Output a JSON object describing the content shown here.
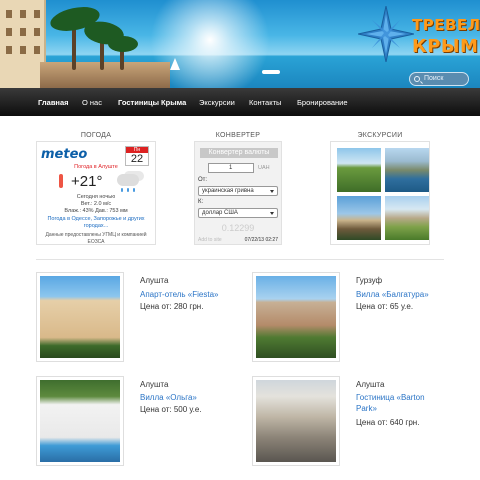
{
  "header": {
    "logo_line1": "ТРЕВЕЛ",
    "logo_line2": "КРЫМ",
    "search_placeholder": "Поиск",
    "accent": "#ff9a1a"
  },
  "nav": {
    "items": [
      {
        "label": "Главная",
        "bold": true
      },
      {
        "label": "О нас",
        "bold": false
      },
      {
        "label": "Гостиницы Крыма",
        "bold": true
      },
      {
        "label": "Экскурсии",
        "bold": false
      },
      {
        "label": "Контакты",
        "bold": false
      },
      {
        "label": "Бронирование",
        "bold": false
      }
    ]
  },
  "widgets": {
    "weather": {
      "title": "ПОГОДА",
      "brand": "meteo",
      "weekday": "Пн",
      "day": "22",
      "city": "Погода в Алуште",
      "temp": "+21°",
      "period": "Сегодня ночью",
      "wind": "Вет.: 2.0 м/с",
      "humidity_pressure": "Влаж.: 43%  Дав.: 753 мм",
      "links": "Погода в Одессе, Запорожье и других городах...",
      "credit": "Данные предоставлены УГМЦ и компанией",
      "partner": "ЕОЗСА"
    },
    "converter": {
      "title": "КОНВЕРТЕР",
      "header": "Конвертер валюты",
      "amount": "1",
      "amount_unit": "UAH",
      "from_label": "От:",
      "from_value": "украинская гривна",
      "to_label": "К:",
      "to_value": "доллар США",
      "result": "0.12299",
      "site": "Add to site",
      "timestamp": "07/22/13 02:27"
    },
    "excursions": {
      "title": "ЭКСКУРСИИ",
      "photos": [
        "valley-photo",
        "coast-photo",
        "castle-photo",
        "mountain-photo"
      ]
    }
  },
  "listings": [
    {
      "location": "Алушта",
      "name_lines": [
        "Апарт-отель «Fiesta»"
      ],
      "price": "Цена от: 280 грн.",
      "photo": "apartment-building-photo"
    },
    {
      "location": "Гурзуф",
      "name_lines": [
        "Вилла «Балгатура»"
      ],
      "price": "Цена от: 65 у.е.",
      "photo": "villa-hillside-photo"
    },
    {
      "location": "Алушта",
      "name_lines": [
        "Вилла «Ольга»"
      ],
      "price": "Цена от: 500 у.е.",
      "photo": "villa-pool-photo"
    },
    {
      "location": "Алушта",
      "name_lines": [
        "Гостиница «Barton",
        "Park»"
      ],
      "price": "Цена от: 640 грн.",
      "photo": "hotel-facade-photo"
    }
  ]
}
